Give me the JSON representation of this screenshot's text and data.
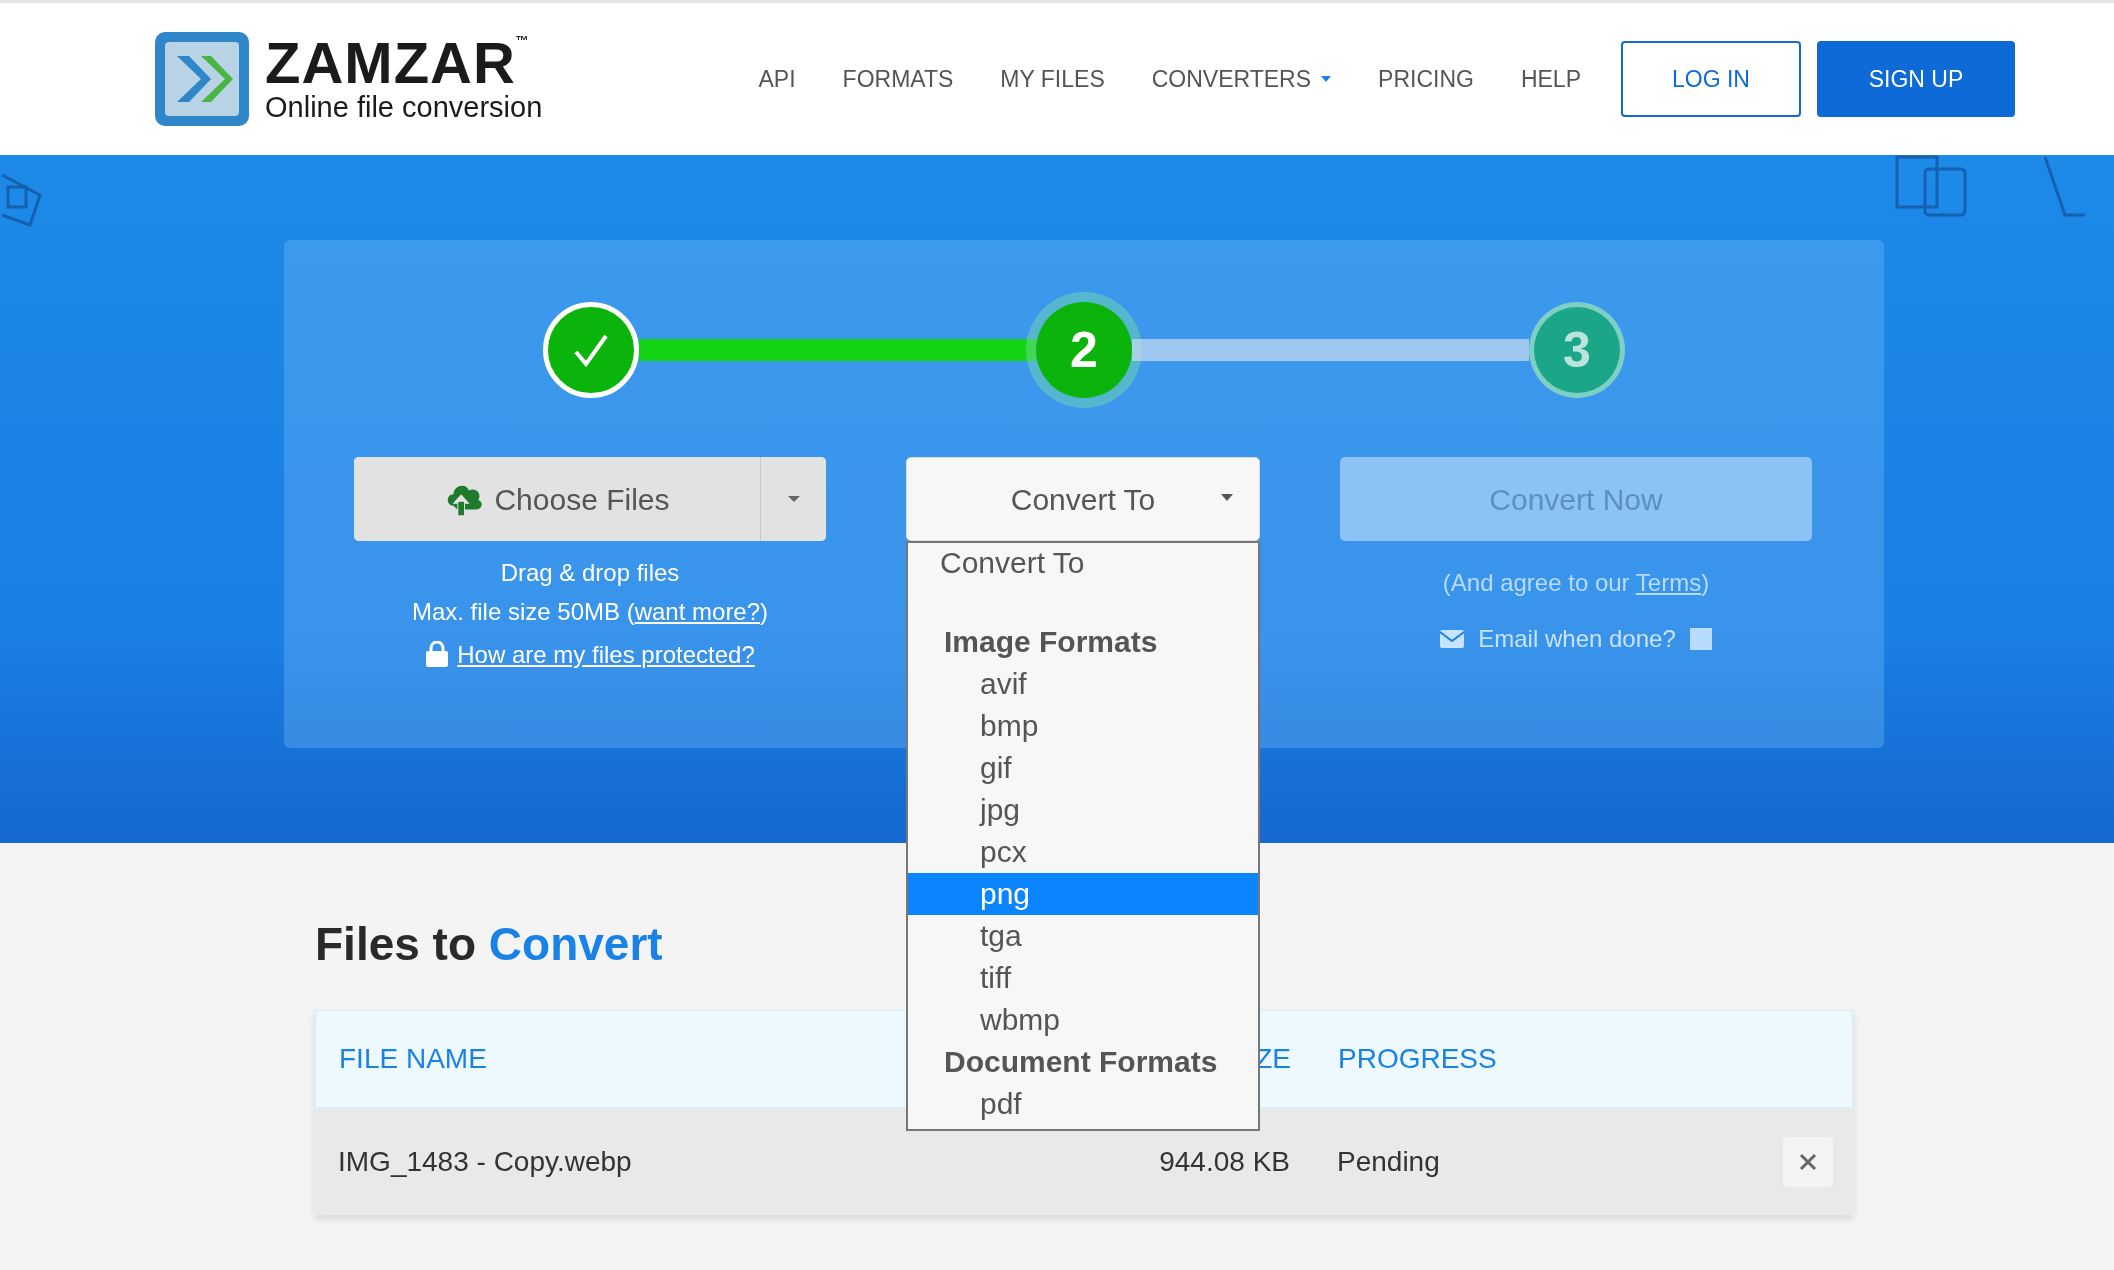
{
  "header": {
    "logo": {
      "name": "ZAMZAR",
      "trademark": "™",
      "tagline": "Online file conversion"
    },
    "nav": [
      {
        "label": "API",
        "has_caret": false
      },
      {
        "label": "FORMATS",
        "has_caret": false
      },
      {
        "label": "MY FILES",
        "has_caret": false
      },
      {
        "label": "CONVERTERS",
        "has_caret": true
      },
      {
        "label": "PRICING",
        "has_caret": false
      },
      {
        "label": "HELP",
        "has_caret": false
      }
    ],
    "buttons": [
      {
        "label": "LOG IN",
        "kind": "outline"
      },
      {
        "label": "SIGN UP",
        "kind": "solid"
      }
    ]
  },
  "steps": [
    {
      "completed": true,
      "current": false
    },
    {
      "label": "2",
      "completed": false,
      "current": true
    },
    {
      "label": "3",
      "completed": false,
      "current": false
    }
  ],
  "choose_files": {
    "label": "Choose Files",
    "hint": "Drag & drop files",
    "max_size": "Max. file size 50MB (",
    "want_more_link": "want more?",
    "max_size_end": ")",
    "protected_link": "How are my files protected?"
  },
  "convert_to": {
    "label": "Convert To",
    "expanded": true,
    "options": [
      {
        "kind": "option",
        "label": "Convert To",
        "selected": false
      },
      {
        "kind": "group",
        "label": "Image Formats"
      },
      {
        "kind": "option",
        "label": "avif",
        "selected": false
      },
      {
        "kind": "option",
        "label": "bmp",
        "selected": false
      },
      {
        "kind": "option",
        "label": "gif",
        "selected": false
      },
      {
        "kind": "option",
        "label": "jpg",
        "selected": false
      },
      {
        "kind": "option",
        "label": "pcx",
        "selected": false
      },
      {
        "kind": "option",
        "label": "png",
        "selected": true
      },
      {
        "kind": "option",
        "label": "tga",
        "selected": false
      },
      {
        "kind": "option",
        "label": "tiff",
        "selected": false
      },
      {
        "kind": "option",
        "label": "wbmp",
        "selected": false
      },
      {
        "kind": "group",
        "label": "Document Formats"
      },
      {
        "kind": "option",
        "label": "pdf",
        "selected": false
      }
    ]
  },
  "convert_now": {
    "label": "Convert Now",
    "disabled": true,
    "terms_prefix": "(And agree to our ",
    "terms_link": "Terms",
    "terms_suffix": ")",
    "email": {
      "label": "Email when done?",
      "checked": false
    }
  },
  "files": {
    "title": "Files to",
    "title_highlight": "Convert",
    "columns": [
      "FILE NAME",
      "ZE",
      "PROGRESS"
    ],
    "rows": [
      {
        "file_name": "IMG_1483 - Copy.webp",
        "size": "944.08 KB",
        "progress": "Pending"
      }
    ]
  }
}
